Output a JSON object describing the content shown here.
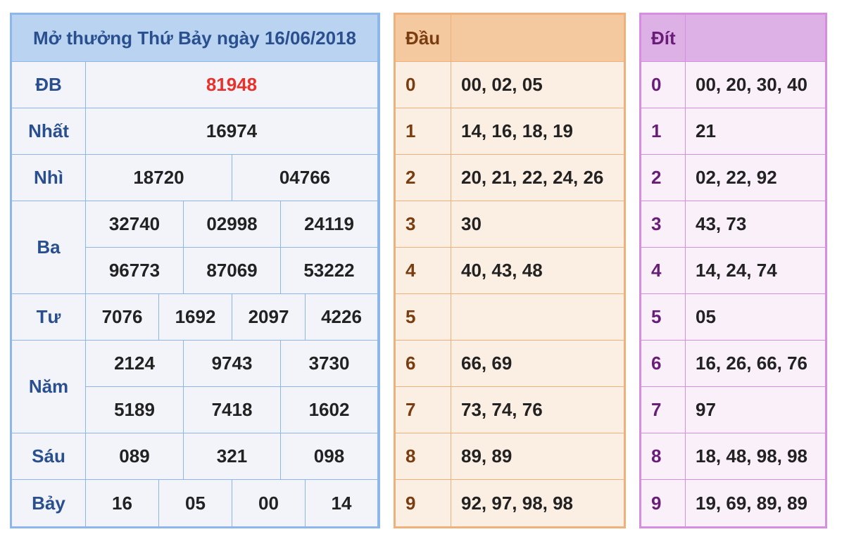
{
  "results": {
    "title": "Mở thưởng Thứ Bảy ngày 16/06/2018",
    "rows": {
      "db": {
        "label": "ĐB",
        "values": [
          "81948"
        ]
      },
      "nhat": {
        "label": "Nhất",
        "values": [
          "16974"
        ]
      },
      "nhi": {
        "label": "Nhì",
        "values": [
          "18720",
          "04766"
        ]
      },
      "ba": {
        "label": "Ba",
        "values": [
          "32740",
          "02998",
          "24119",
          "96773",
          "87069",
          "53222"
        ]
      },
      "tu": {
        "label": "Tư",
        "values": [
          "7076",
          "1692",
          "2097",
          "4226"
        ]
      },
      "nam": {
        "label": "Năm",
        "values": [
          "2124",
          "9743",
          "3730",
          "5189",
          "7418",
          "1602"
        ]
      },
      "sau": {
        "label": "Sáu",
        "values": [
          "089",
          "321",
          "098"
        ]
      },
      "bay": {
        "label": "Bảy",
        "values": [
          "16",
          "05",
          "00",
          "14"
        ]
      }
    },
    "special_color": "#e8312a"
  },
  "dau": {
    "header": "Đầu",
    "rows": [
      {
        "key": "0",
        "values": "00, 02, 05"
      },
      {
        "key": "1",
        "values": "14, 16, 18, 19"
      },
      {
        "key": "2",
        "values": "20, 21, 22, 24, 26"
      },
      {
        "key": "3",
        "values": "30"
      },
      {
        "key": "4",
        "values": "40, 43, 48"
      },
      {
        "key": "5",
        "values": ""
      },
      {
        "key": "6",
        "values": "66, 69"
      },
      {
        "key": "7",
        "values": "73, 74, 76"
      },
      {
        "key": "8",
        "values": "89, 89"
      },
      {
        "key": "9",
        "values": "92, 97, 98, 98"
      }
    ]
  },
  "dit": {
    "header": "Đít",
    "rows": [
      {
        "key": "0",
        "values": "00, 20, 30, 40"
      },
      {
        "key": "1",
        "values": "21"
      },
      {
        "key": "2",
        "values": "02, 22, 92"
      },
      {
        "key": "3",
        "values": "43, 73"
      },
      {
        "key": "4",
        "values": "14, 24, 74"
      },
      {
        "key": "5",
        "values": "05"
      },
      {
        "key": "6",
        "values": "16, 26, 66, 76"
      },
      {
        "key": "7",
        "values": "97"
      },
      {
        "key": "8",
        "values": "18, 48, 98, 98"
      },
      {
        "key": "9",
        "values": "19, 69, 89, 89"
      }
    ]
  }
}
